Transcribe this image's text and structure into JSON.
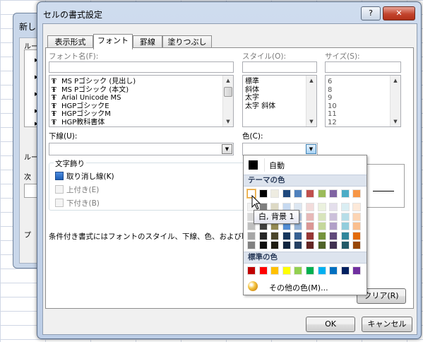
{
  "dialog": {
    "title": "セルの書式設定",
    "help_label": "?",
    "close_label": "✕",
    "ok_label": "OK",
    "cancel_label": "キャンセル"
  },
  "background_dialog": {
    "title": "新し",
    "label1": "ルー",
    "label2": "ルー",
    "label3": "次",
    "label4": "プ"
  },
  "tabs": [
    "表示形式",
    "フォント",
    "罫線",
    "塗りつぶし"
  ],
  "font": {
    "font_name_label": "フォント名(F):",
    "style_label": "スタイル(O):",
    "size_label": "サイズ(S):",
    "font_list": [
      "MS Pゴシック (見出し)",
      "MS Pゴシック (本文)",
      "Arial Unicode MS",
      "HGPゴシックE",
      "HGPゴシックM",
      "HGP教科書体"
    ],
    "font_icon": "Ŧ",
    "style_list": [
      "標準",
      "斜体",
      "太字",
      "太字 斜体"
    ],
    "size_list": [
      "6",
      "8",
      "9",
      "10",
      "11",
      "12"
    ],
    "underline_label": "下線(U):",
    "color_label": "色(C):",
    "effects_title": "文字飾り",
    "strikethrough_label": "取り消し線(K)",
    "superscript_label": "上付き(E)",
    "subscript_label": "下付き(B)",
    "note_text": "条件付き書式にはフォントのスタイル、下線、色、および取り",
    "clear_label": "クリア(R)"
  },
  "color_popup": {
    "automatic_label": "自動",
    "theme_header": "テーマの色",
    "standard_header": "標準の色",
    "more_colors_label": "その他の色(M)...",
    "theme_top_row": [
      "#FFFFFF",
      "#000000",
      "#EEECE1",
      "#1F497D",
      "#4F81BD",
      "#C0504D",
      "#9BBB59",
      "#8064A2",
      "#4BACC6",
      "#F79646"
    ],
    "theme_shades": [
      [
        "#F2F2F2",
        "#7F7F7F",
        "#DDD9C4",
        "#C6D9F0",
        "#DCE6F1",
        "#F2DCDB",
        "#EBF1DE",
        "#E4DFEC",
        "#DAEEF3",
        "#FDE9D9"
      ],
      [
        "#D9D9D9",
        "#595959",
        "#C4BD97",
        "#8DB4E2",
        "#B8CCE4",
        "#E6B8B7",
        "#D8E4BC",
        "#CCC0DA",
        "#B7DEE8",
        "#FCD5B4"
      ],
      [
        "#BFBFBF",
        "#404040",
        "#948A54",
        "#538DD5",
        "#95B3D7",
        "#DA9694",
        "#C4D79B",
        "#B1A0C7",
        "#92CDDC",
        "#FABF8F"
      ],
      [
        "#A6A6A6",
        "#262626",
        "#4A452A",
        "#16365C",
        "#366092",
        "#963634",
        "#76933C",
        "#60497A",
        "#31869B",
        "#E26B0A"
      ],
      [
        "#808080",
        "#0D0D0D",
        "#1D1B10",
        "#0F243E",
        "#244062",
        "#632523",
        "#4F6228",
        "#403151",
        "#215967",
        "#974706"
      ]
    ],
    "standard_colors": [
      "#C00000",
      "#FF0000",
      "#FFC000",
      "#FFFF00",
      "#92D050",
      "#00B050",
      "#00B0F0",
      "#0070C0",
      "#002060",
      "#7030A0"
    ],
    "tooltip": "白, 背景 1"
  }
}
